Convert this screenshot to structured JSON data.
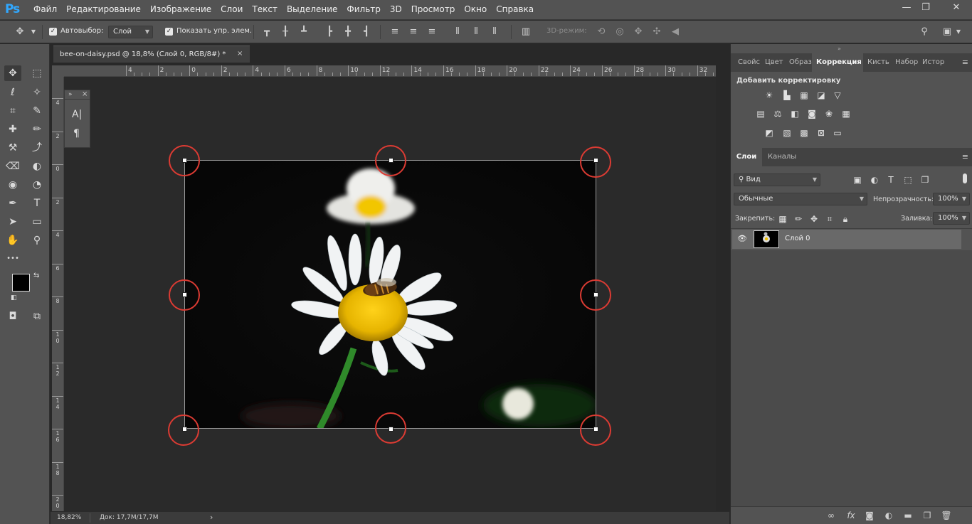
{
  "app": {
    "logo": "Ps",
    "menu": [
      "Файл",
      "Редактирование",
      "Изображение",
      "Слои",
      "Текст",
      "Выделение",
      "Фильтр",
      "3D",
      "Просмотр",
      "Окно",
      "Справка"
    ],
    "window_controls": {
      "minimize": "—",
      "restore": "❐",
      "close": "✕"
    }
  },
  "options": {
    "autoselect_label": "Автовыбор:",
    "autoselect_value": "Слой",
    "show_controls_label": "Показать упр. элем.",
    "mode_3d_label": "3D-режим:",
    "check_mark": "✓"
  },
  "document": {
    "tab_title": "bee-on-daisy.psd @ 18,8% (Слой 0, RGB/8#) *",
    "close_glyph": "×",
    "ruler_top": [
      "4",
      "2",
      "0",
      "2",
      "4",
      "6",
      "8",
      "10",
      "12",
      "14",
      "16",
      "18",
      "20",
      "22",
      "24",
      "26",
      "28",
      "30",
      "32"
    ],
    "ruler_left": [
      "4",
      "2",
      "0",
      "2",
      "4",
      "6",
      "8",
      "10",
      "12",
      "14",
      "16",
      "18",
      "20"
    ],
    "zoom": "18,82%",
    "doc_size": "Док: 17,7M/17,7M",
    "status_arrow": "›"
  },
  "float_panel": {
    "collapse": "»",
    "close": "×",
    "char_icon": "A|",
    "para_icon": "¶"
  },
  "right_panel": {
    "top_tabs": [
      "Свойс",
      "Цвет",
      "Образ",
      "Коррекция",
      "Кисть",
      "Набор",
      "Истор"
    ],
    "active_tab": "Коррекция",
    "add_adjustment": "Добавить корректировку",
    "layer_tabs": [
      "Слои",
      "Каналы"
    ],
    "filter_kind": "Вид",
    "blend_mode": "Обычные",
    "opacity_label": "Непрозрачность:",
    "opacity_value": "100%",
    "lock_label": "Закрепить:",
    "fill_label": "Заливка:",
    "fill_value": "100%",
    "menu_glyph": "≡",
    "layers": [
      {
        "name": "Слой 0",
        "visible": true,
        "eye": "👁"
      }
    ]
  },
  "icons": {
    "move": "✥",
    "marquee": "⬚",
    "lasso": "ℓ",
    "magic": "✧",
    "crop": "⌗",
    "eyedropper": "✎",
    "heal": "✚",
    "brush": "✏",
    "stamp": "⚒",
    "history": "⤴",
    "eraser": "⌫",
    "bucket": "◐",
    "blur": "◉",
    "dodge": "◔",
    "pen": "✒",
    "text": "T",
    "path": "➤",
    "shape": "▭",
    "hand": "✋",
    "zoom": "⚲",
    "more": "•••"
  },
  "colors": {
    "accent": "#31a8ff",
    "ring": "#dc3b33",
    "fg": "#000000",
    "bg": "#ffffff"
  }
}
